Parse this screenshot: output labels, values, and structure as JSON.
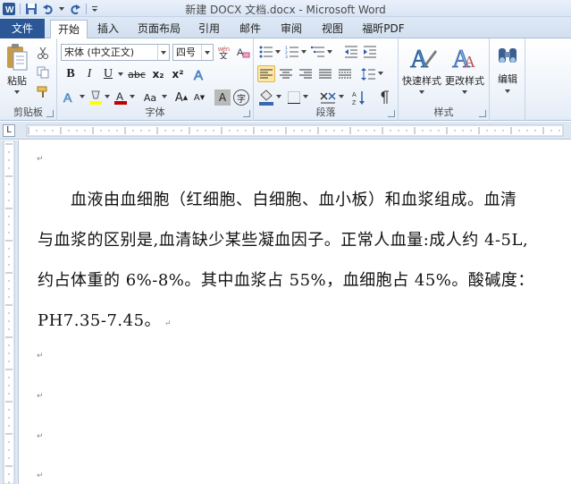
{
  "window": {
    "title": "新建 DOCX 文档.docx - Microsoft Word"
  },
  "tabs": {
    "file": "文件",
    "items": [
      "开始",
      "插入",
      "页面布局",
      "引用",
      "邮件",
      "审阅",
      "视图",
      "福昕PDF"
    ]
  },
  "ribbon": {
    "clipboard": {
      "label": "剪贴板",
      "paste": "粘贴"
    },
    "font": {
      "label": "字体",
      "font_name": "宋体 (中文正文)",
      "font_size": "四号",
      "bold": "B",
      "italic": "I",
      "underline": "U",
      "strike": "abc",
      "subscript": "x₂",
      "superscript": "x²",
      "grow": "A",
      "shrink": "A",
      "case": "Aa",
      "char_shade": "A",
      "enclose": "字"
    },
    "paragraph": {
      "label": "段落"
    },
    "styles": {
      "label": "样式",
      "quick": "快速样式",
      "change": "更改样式"
    },
    "editing": {
      "label": "编辑"
    }
  },
  "document": {
    "paragraph": [
      "　　血液由血细胞（红细胞、白细胞、血小板）和血浆组成。血清",
      "与血浆的区别是,血清缺少某些凝血因子。正常人血量:成人约 4-5L,",
      "约占体重的 6%-8%。其中血浆占 55%，血细胞占 45%。酸碱度：",
      "PH7.35-7.45。"
    ]
  },
  "colors": {
    "file_tab": "#2b5797",
    "highlight": "#ffff00",
    "font_color": "#c00000"
  }
}
